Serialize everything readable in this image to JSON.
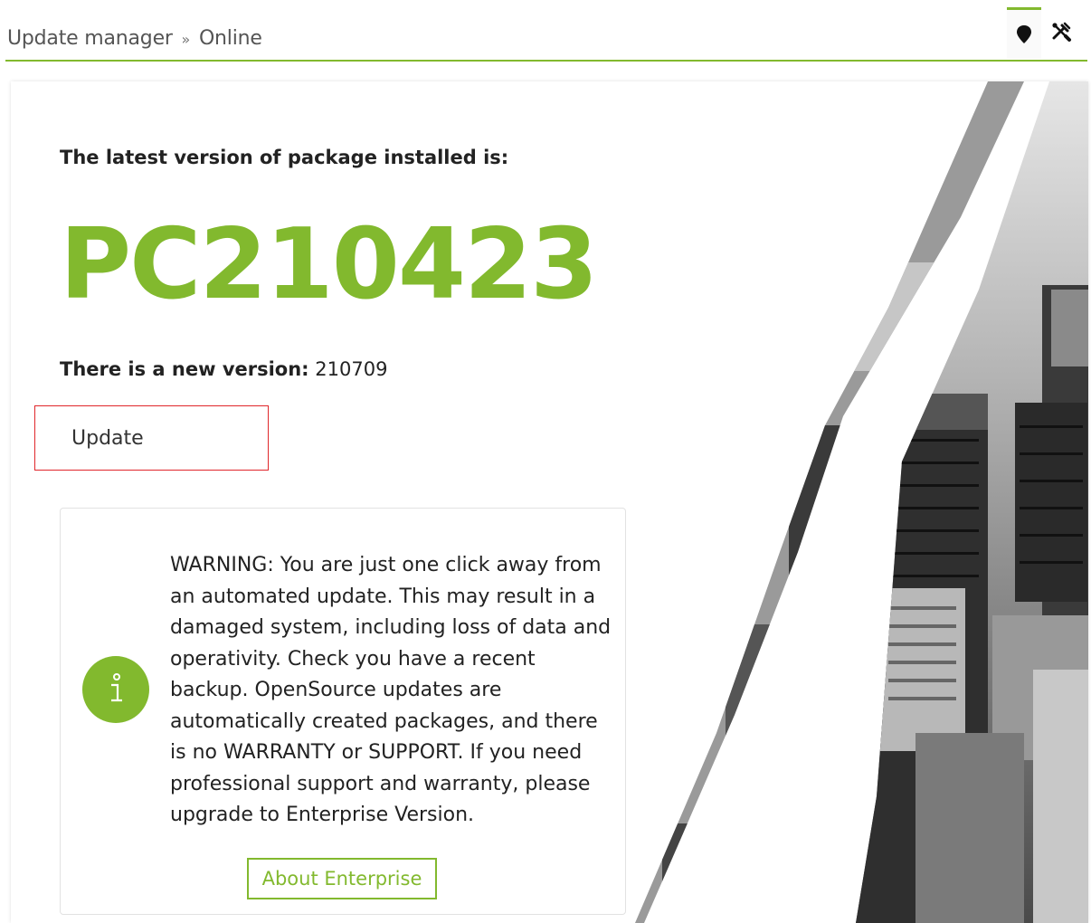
{
  "header": {
    "breadcrumb_section": "Update manager",
    "breadcrumb_separator": "»",
    "breadcrumb_current": "Online",
    "tabs": [
      {
        "icon": "map-marker-icon",
        "active": true
      },
      {
        "icon": "tools-icon",
        "active": false
      }
    ]
  },
  "main": {
    "installed_label": "The latest version of package installed is:",
    "installed_version": "PC210423",
    "new_version_label": "There is a new version:",
    "new_version_value": "210709",
    "update_button": "Update",
    "warning": {
      "icon": "info-icon",
      "text": "WARNING: You are just one click away from an automated update. This may result in a damaged system, including loss of data and operativity. Check you have a recent backup. OpenSource updates are automatically created packages, and there is no WARRANTY or SUPPORT. If you need professional support and warranty, please upgrade to Enterprise Version.",
      "about_button": "About Enterprise"
    }
  },
  "colors": {
    "accent": "#82b92e",
    "highlight_border": "#e0262b"
  }
}
